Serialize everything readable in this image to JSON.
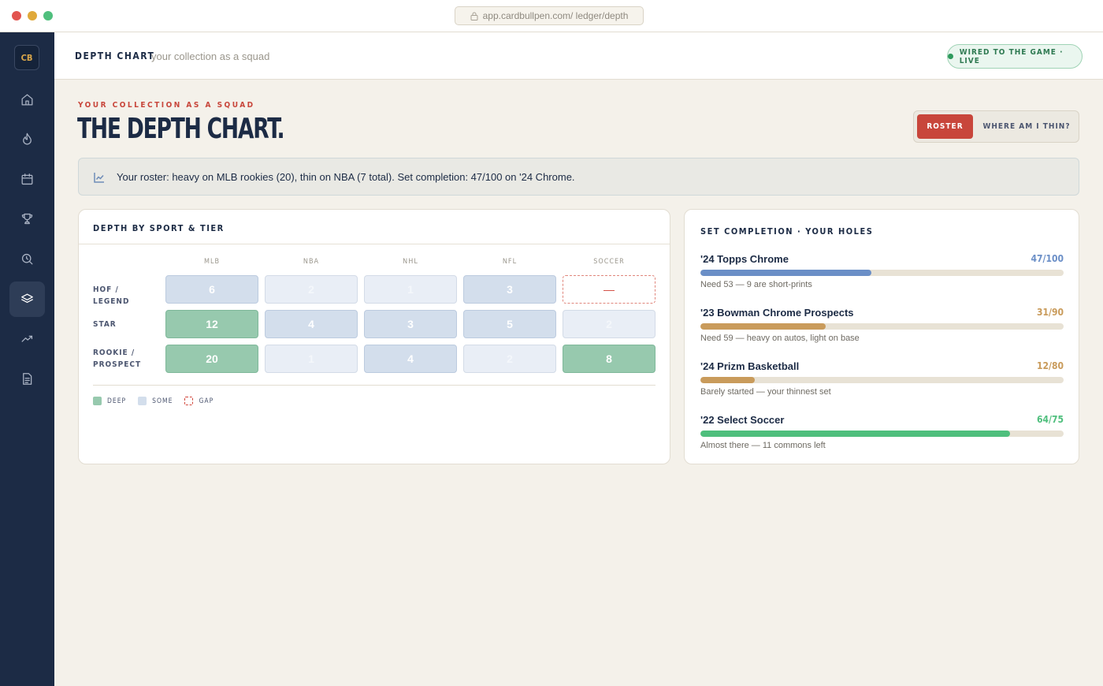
{
  "browser": {
    "url": "app.cardbullpen.com/  ledger/depth"
  },
  "sidebar": {
    "logo": "CB",
    "items": [
      {
        "icon": "home-icon"
      },
      {
        "icon": "flame-icon"
      },
      {
        "icon": "calendar-icon"
      },
      {
        "icon": "trophy-icon"
      },
      {
        "icon": "search-clock-icon"
      },
      {
        "icon": "layers-icon",
        "active": true
      },
      {
        "icon": "trend-icon"
      },
      {
        "icon": "document-icon"
      }
    ]
  },
  "header": {
    "title": "DEPTH CHART",
    "subtitle": "your collection as a squad",
    "live_badge": "WIRED TO THE GAME · LIVE"
  },
  "hero": {
    "eyebrow": "YOUR COLLECTION AS A SQUAD",
    "title": "THE DEPTH CHART.",
    "toggle": {
      "active": "ROSTER",
      "inactive": "WHERE AM I THIN?"
    }
  },
  "insight": {
    "icon": "line-chart-icon",
    "text": "Your roster: heavy on MLB rookies (20), thin on NBA (7 total). Set completion: 47/100 on '24 Chrome."
  },
  "depth": {
    "title": "DEPTH BY SPORT & TIER",
    "columns": [
      "MLB",
      "NBA",
      "NHL",
      "NFL",
      "SOCCER"
    ],
    "rows": [
      {
        "label": "HOF / LEGEND",
        "cells": [
          {
            "value": "6",
            "level": "some"
          },
          {
            "value": "2",
            "level": "thin"
          },
          {
            "value": "1",
            "level": "thin"
          },
          {
            "value": "3",
            "level": "some"
          },
          {
            "value": "—",
            "level": "gap"
          }
        ]
      },
      {
        "label": "STAR",
        "cells": [
          {
            "value": "12",
            "level": "deep"
          },
          {
            "value": "4",
            "level": "some"
          },
          {
            "value": "3",
            "level": "some"
          },
          {
            "value": "5",
            "level": "some"
          },
          {
            "value": "2",
            "level": "thin"
          }
        ]
      },
      {
        "label": "ROOKIE / PROSPECT",
        "cells": [
          {
            "value": "20",
            "level": "deep"
          },
          {
            "value": "1",
            "level": "thin"
          },
          {
            "value": "4",
            "level": "some"
          },
          {
            "value": "2",
            "level": "thin"
          },
          {
            "value": "8",
            "level": "deep"
          }
        ]
      }
    ],
    "legend": {
      "deep": "DEEP",
      "some": "SOME",
      "gap": "GAP"
    }
  },
  "sets": {
    "title": "SET COMPLETION · YOUR HOLES",
    "items": [
      {
        "name": "'24 Topps Chrome",
        "count": "47/100",
        "fraction": 0.47,
        "color": "#6b8fc7",
        "note": "Need 53 — 9 are short-prints"
      },
      {
        "name": "'23 Bowman Chrome Prospects",
        "count": "31/90",
        "fraction": 0.344,
        "color": "#c99b5b",
        "note": "Need 59 — heavy on autos, light on base"
      },
      {
        "name": "'24 Prizm Basketball",
        "count": "12/80",
        "fraction": 0.15,
        "color": "#c99b5b",
        "note": "Barely started — your thinnest set"
      },
      {
        "name": "'22 Select Soccer",
        "count": "64/75",
        "fraction": 0.853,
        "color": "#4fbf7d",
        "note": "Almost there — 11 commons left"
      }
    ]
  }
}
